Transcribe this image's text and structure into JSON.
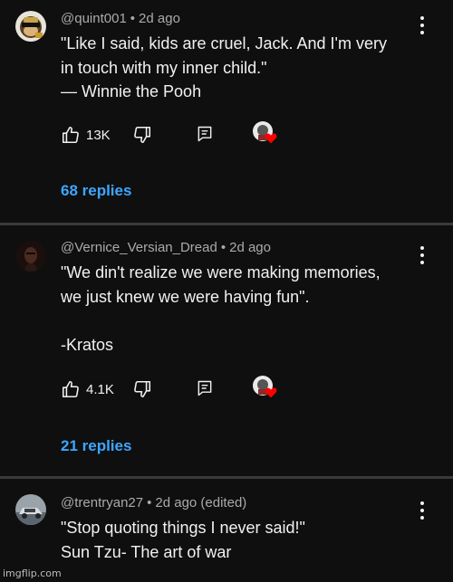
{
  "comments": [
    {
      "handle": "@quint001",
      "separator": "•",
      "time": "2d ago",
      "lines": [
        "\"Like I said, kids are cruel, Jack. And I'm very",
        "in touch with my inner child.\"",
        "— Winnie the Pooh"
      ],
      "likes": "13K",
      "replies": "68 replies",
      "avatar_icon": "monkey-avatar-icon"
    },
    {
      "handle": "@Vernice_Versian_Dread",
      "separator": "•",
      "time": "2d ago",
      "lines": [
        "\"We din't realize we were making memories,",
        "we just knew we were having fun\".",
        "",
        "-Kratos"
      ],
      "likes": "4.1K",
      "replies": "21 replies",
      "avatar_icon": "dark-portrait-avatar-icon"
    },
    {
      "handle": "@trentryan27",
      "separator": "•",
      "time": "2d ago (edited)",
      "lines": [
        "\"Stop quoting things I never said!\"",
        "Sun Tzu- The art of war"
      ],
      "avatar_icon": "car-avatar-icon"
    }
  ],
  "watermark": "imgflip.com",
  "colors": {
    "background": "#0f0f0f",
    "replies": "#3ea6ff",
    "heart": "#ff0000",
    "divider": "#3a3a3a"
  }
}
